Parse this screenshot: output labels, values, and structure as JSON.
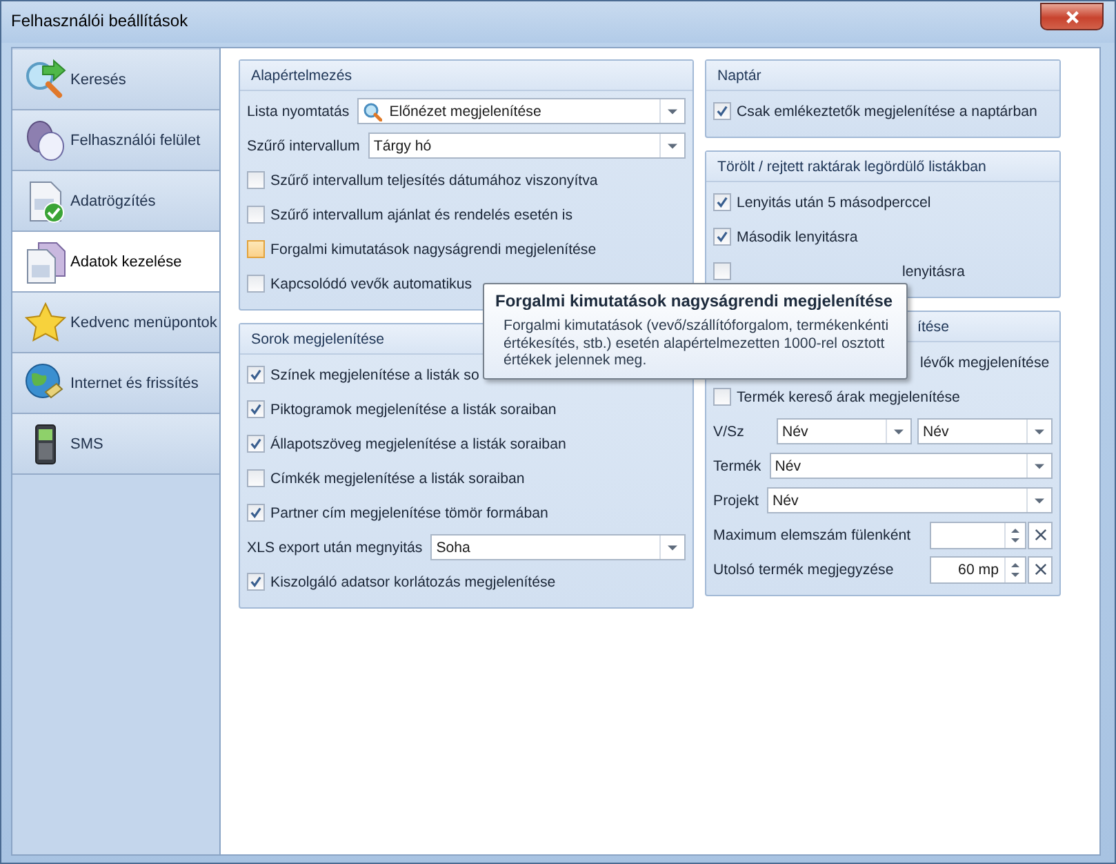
{
  "window": {
    "title": "Felhasználói beállítások"
  },
  "sidebar": {
    "items": [
      {
        "label": "Keresés",
        "selected": false
      },
      {
        "label": "Felhasználói felület",
        "selected": false
      },
      {
        "label": "Adatrögzítés",
        "selected": false
      },
      {
        "label": "Adatok kezelése",
        "selected": true
      },
      {
        "label": "Kedvenc menüpontok",
        "selected": false
      },
      {
        "label": "Internet és frissítés",
        "selected": false
      },
      {
        "label": "SMS",
        "selected": false
      }
    ]
  },
  "columns": [
    {
      "groups": [
        {
          "title": "Alapértelmezés",
          "rows": [
            {
              "kind": "search-select",
              "label": "Lista nyomtatás",
              "value": "Előnézet megjelenítése"
            },
            {
              "kind": "select",
              "label": "Szűrő intervallum",
              "value": "Tárgy hó"
            },
            {
              "kind": "checkbox",
              "label": "Szűrő intervallum teljesítés dátumához viszonyítva",
              "checked": false
            },
            {
              "kind": "checkbox",
              "label": "Szűrő intervallum ajánlat és rendelés esetén is",
              "checked": false
            },
            {
              "kind": "hovered-checkbox",
              "label": "Forgalmi kimutatások nagyságrendi megjelenítése",
              "checked": false
            },
            {
              "kind": "checkbox",
              "label": "Kapcsolódó vevők automatikus",
              "checked": false
            }
          ]
        },
        {
          "title": "Sorok megjelenítése",
          "rows": [
            {
              "kind": "checkbox",
              "label": "Színek megjelenítése a listák so",
              "checked": true
            },
            {
              "kind": "checkbox",
              "label": "Piktogramok megjelenítése a listák soraiban",
              "checked": true
            },
            {
              "kind": "checkbox",
              "label": "Állapotszöveg megjelenítése a listák soraiban",
              "checked": true
            },
            {
              "kind": "checkbox",
              "label": "Címkék megjelenítése a listák soraiban",
              "checked": false
            },
            {
              "kind": "checkbox",
              "label": "Partner cím megjelenítése tömör formában",
              "checked": true
            },
            {
              "kind": "select",
              "label": "XLS export után megnyitás",
              "value": "Soha"
            },
            {
              "kind": "checkbox",
              "label": "Kiszolgáló adatsor korlátozás megjelenítése",
              "checked": true
            }
          ]
        }
      ]
    },
    {
      "groups": [
        {
          "title": "Naptár",
          "rows": [
            {
              "kind": "checkbox",
              "label": "Csak emlékeztetők megjelenítése a naptárban",
              "checked": true
            }
          ]
        },
        {
          "title": "Törölt / rejtett raktárak legördülő listákban",
          "rows": [
            {
              "kind": "checkbox",
              "label": "Lenyitás után 5 másodperccel",
              "checked": true
            },
            {
              "kind": "checkbox",
              "label": "Második lenyitásra",
              "checked": true
            },
            {
              "kind": "checkbox",
              "label": "lenyitásra",
              "checked": false,
              "covered": true
            }
          ]
        },
        {
          "title": "ítése",
          "covered": true,
          "rows": [
            {
              "kind": "text",
              "label": "lévők megjelenítése",
              "covered": true
            },
            {
              "kind": "checkbox",
              "label": "Termék kereső árak megjelenítése",
              "checked": false
            },
            {
              "kind": "pair",
              "label": "V/Sz",
              "values": [
                "Név",
                "Név"
              ]
            },
            {
              "kind": "select",
              "label": "Termék",
              "value": "Név"
            },
            {
              "kind": "select",
              "label": "Projekt",
              "value": "Név"
            },
            {
              "kind": "spin",
              "label": "Maximum elemszám fülenként"
            },
            {
              "kind": "spin",
              "label": "Utolsó termék megjegyzése",
              "value": "60 mp"
            }
          ]
        }
      ]
    }
  ],
  "tooltip": {
    "title": "Forgalmi kimutatások nagyságrendi megjelenítése",
    "text": "Forgalmi kimutatások (vevő/szállítóforgalom, termékenkénti értékesítés, stb.) esetén alapértelmezetten 1000-rel osztott értékek jelennek meg."
  }
}
